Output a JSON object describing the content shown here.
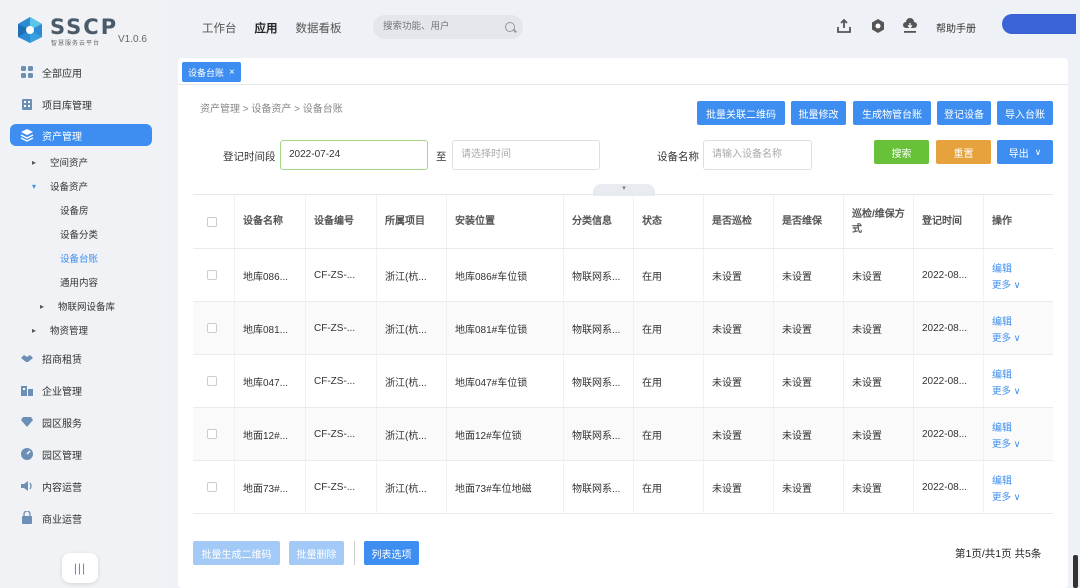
{
  "app": {
    "name": "SSCP",
    "subtitle": "智慧服务云平台",
    "version": "V1.0.6"
  },
  "topbar": {
    "nav": [
      "工作台",
      "应用",
      "数据看板"
    ],
    "active_nav": "应用",
    "search_placeholder": "搜索功能、用户",
    "help_label": "帮助手册",
    "icons": [
      "upload-icon",
      "hexagon-settings-icon",
      "cloud-download-icon"
    ]
  },
  "sidebar": {
    "items": [
      {
        "label": "全部应用",
        "icon": "grid-icon"
      },
      {
        "label": "项目库管理",
        "icon": "building-icon"
      },
      {
        "label": "资产管理",
        "icon": "layers-icon",
        "active": true
      },
      {
        "label": "招商租赁",
        "icon": "handshake-icon"
      },
      {
        "label": "企业管理",
        "icon": "enterprise-icon"
      },
      {
        "label": "园区服务",
        "icon": "diamond-icon"
      },
      {
        "label": "园区管理",
        "icon": "dashboard-icon"
      },
      {
        "label": "内容运营",
        "icon": "speaker-icon"
      },
      {
        "label": "商业运营",
        "icon": "shop-icon"
      }
    ],
    "asset_sub": {
      "space": "空间资产",
      "device": "设备资产",
      "device_children": [
        "设备房",
        "设备分类",
        "设备台账",
        "通用内容"
      ],
      "iot": "物联网设备库",
      "material": "物资管理"
    },
    "collapse_label": "|||"
  },
  "tab": {
    "label": "设备台账",
    "close": "×"
  },
  "breadcrumb": "资产管理 > 设备资产 > 设备台账",
  "actions": [
    "批量关联二维码",
    "批量修改",
    "生成物管台账",
    "登记设备",
    "导入台账"
  ],
  "filters": {
    "time_label": "登记时间段",
    "start_value": "2022-07-24",
    "to_label": "至",
    "end_placeholder": "请选择时间",
    "name_label": "设备名称",
    "name_placeholder": "请输入设备名称",
    "search_btn": "搜索",
    "reset_btn": "重置",
    "export_btn": "导出"
  },
  "collapse_toggle": "▾",
  "table": {
    "columns": [
      "设备名称",
      "设备编号",
      "所属项目",
      "安装位置",
      "分类信息",
      "状态",
      "是否巡检",
      "是否维保",
      "巡检/维保方式",
      "登记时间",
      "操作"
    ],
    "rows": [
      [
        "地库086...",
        "CF-ZS-...",
        "浙江(杭...",
        "地库086#车位锁",
        "物联网系...",
        "在用",
        "未设置",
        "未设置",
        "未设置",
        "2022-08..."
      ],
      [
        "地库081...",
        "CF-ZS-...",
        "浙江(杭...",
        "地库081#车位锁",
        "物联网系...",
        "在用",
        "未设置",
        "未设置",
        "未设置",
        "2022-08..."
      ],
      [
        "地库047...",
        "CF-ZS-...",
        "浙江(杭...",
        "地库047#车位锁",
        "物联网系...",
        "在用",
        "未设置",
        "未设置",
        "未设置",
        "2022-08..."
      ],
      [
        "地面12#...",
        "CF-ZS-...",
        "浙江(杭...",
        "地面12#车位锁",
        "物联网系...",
        "在用",
        "未设置",
        "未设置",
        "未设置",
        "2022-08..."
      ],
      [
        "地面73#...",
        "CF-ZS-...",
        "浙江(杭...",
        "地面73#车位地磁",
        "物联网系...",
        "在用",
        "未设置",
        "未设置",
        "未设置",
        "2022-08..."
      ]
    ],
    "op_edit": "编辑",
    "op_more": "更多 ∨"
  },
  "bottom": {
    "batch_qr": "批量生成二维码",
    "batch_delete": "批量删除",
    "list_options": "列表选项",
    "pagination": "第1页/共1页 共5条"
  },
  "colors": {
    "primary": "#3d8ef0",
    "green": "#67c23a",
    "orange": "#e6a23c",
    "user_pill": "#3b63d8"
  }
}
